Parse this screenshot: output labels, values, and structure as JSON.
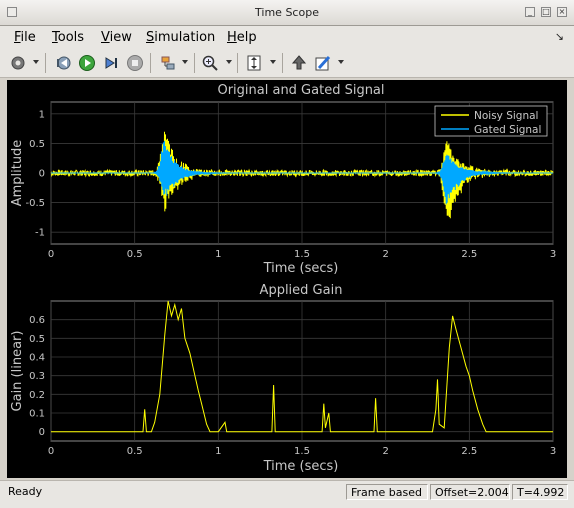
{
  "window": {
    "title": "Time Scope"
  },
  "menu": [
    {
      "label": "File",
      "u": "F",
      "rest": "ile"
    },
    {
      "label": "Tools",
      "u": "T",
      "rest": "ools"
    },
    {
      "label": "View",
      "u": "V",
      "rest": "iew"
    },
    {
      "label": "Simulation",
      "u": "S",
      "rest": "imulation"
    },
    {
      "label": "Help",
      "u": "H",
      "rest": "elp"
    }
  ],
  "toolbar": {
    "icons": [
      "gear-icon",
      "step-back-icon",
      "run-icon",
      "step-forward-icon",
      "stop-icon",
      "highlight-icon",
      "zoom-in-icon",
      "scale-axes-icon",
      "restore-view-icon",
      "style-edit-icon"
    ]
  },
  "colors": {
    "noisy": "#ffff00",
    "gated": "#00a8ff",
    "axes_bg": "#000000",
    "grid": "#3a3a3a",
    "text": "#c8c8c8"
  },
  "chart_data": [
    {
      "type": "line",
      "title": "Original and Gated Signal",
      "xlabel": "Time (secs)",
      "ylabel": "Amplitude",
      "xlim": [
        0,
        3
      ],
      "ylim": [
        -1.2,
        1.2
      ],
      "xticks": [
        "0",
        "0.5",
        "1",
        "1.5",
        "2",
        "2.5",
        "3"
      ],
      "yticks": [
        "1",
        "0.5",
        "0",
        "-0.5",
        "-1"
      ],
      "grid": true,
      "legend": "top-right",
      "series": [
        {
          "name": "Noisy Signal",
          "color": "#ffff00",
          "noise_amplitude": 0.05,
          "bursts": [
            {
              "t": 0.68,
              "peak": 0.9
            },
            {
              "t": 2.37,
              "peak": 1.0
            }
          ]
        },
        {
          "name": "Gated Signal",
          "color": "#00a8ff",
          "noise_amplitude": 0.0,
          "bursts": [
            {
              "t": 0.68,
              "peak": 0.6
            },
            {
              "t": 2.37,
              "peak": 0.6
            }
          ]
        }
      ]
    },
    {
      "type": "line",
      "title": "Applied Gain",
      "xlabel": "Time (secs)",
      "ylabel": "Gain (linear)",
      "xlim": [
        0,
        3
      ],
      "ylim": [
        -0.05,
        0.7
      ],
      "xticks": [
        "0",
        "0.5",
        "1",
        "1.5",
        "2",
        "2.5",
        "3"
      ],
      "yticks": [
        "0.6",
        "0.5",
        "0.4",
        "0.3",
        "0.2",
        "0.1",
        "0"
      ],
      "grid": true,
      "series": [
        {
          "name": "",
          "color": "#ffff00",
          "points": [
            [
              0,
              0
            ],
            [
              0.55,
              0
            ],
            [
              0.56,
              0.12
            ],
            [
              0.57,
              0
            ],
            [
              0.6,
              0
            ],
            [
              0.62,
              0.05
            ],
            [
              0.65,
              0.2
            ],
            [
              0.68,
              0.52
            ],
            [
              0.7,
              0.7
            ],
            [
              0.72,
              0.62
            ],
            [
              0.74,
              0.68
            ],
            [
              0.76,
              0.6
            ],
            [
              0.78,
              0.66
            ],
            [
              0.8,
              0.5
            ],
            [
              0.83,
              0.42
            ],
            [
              0.86,
              0.3
            ],
            [
              0.88,
              0.22
            ],
            [
              0.9,
              0.15
            ],
            [
              0.93,
              0.04
            ],
            [
              0.95,
              0
            ],
            [
              1.0,
              0
            ],
            [
              1.04,
              0.05
            ],
            [
              1.05,
              0
            ],
            [
              1.32,
              0
            ],
            [
              1.33,
              0.25
            ],
            [
              1.34,
              0
            ],
            [
              1.62,
              0
            ],
            [
              1.63,
              0.15
            ],
            [
              1.64,
              0.02
            ],
            [
              1.66,
              0.1
            ],
            [
              1.67,
              0
            ],
            [
              1.93,
              0
            ],
            [
              1.94,
              0.18
            ],
            [
              1.95,
              0
            ],
            [
              2.28,
              0
            ],
            [
              2.3,
              0.12
            ],
            [
              2.31,
              0.28
            ],
            [
              2.32,
              0.04
            ],
            [
              2.35,
              0.02
            ],
            [
              2.38,
              0.45
            ],
            [
              2.4,
              0.62
            ],
            [
              2.42,
              0.55
            ],
            [
              2.45,
              0.45
            ],
            [
              2.48,
              0.35
            ],
            [
              2.5,
              0.3
            ],
            [
              2.52,
              0.22
            ],
            [
              2.55,
              0.12
            ],
            [
              2.58,
              0.04
            ],
            [
              2.6,
              0
            ],
            [
              3.0,
              0
            ]
          ]
        }
      ]
    }
  ],
  "status": {
    "ready": "Ready",
    "frame": "Frame based",
    "offset": "Offset=2.004",
    "time": "T=4.992"
  }
}
